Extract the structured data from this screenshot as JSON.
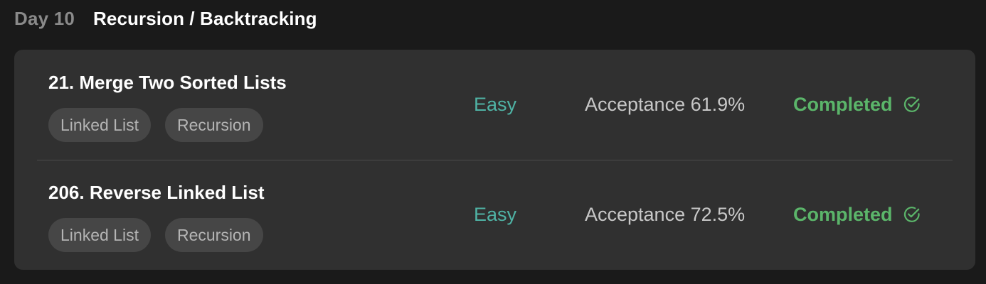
{
  "header": {
    "day": "Day 10",
    "topic": "Recursion / Backtracking"
  },
  "problems": [
    {
      "title": "21. Merge Two Sorted Lists",
      "tags": [
        "Linked List",
        "Recursion"
      ],
      "difficulty": "Easy",
      "acceptance": "Acceptance 61.9%",
      "status": "Completed",
      "status_icon": "check-circle-icon"
    },
    {
      "title": "206. Reverse Linked List",
      "tags": [
        "Linked List",
        "Recursion"
      ],
      "difficulty": "Easy",
      "acceptance": "Acceptance 72.5%",
      "status": "Completed",
      "status_icon": "check-circle-icon"
    }
  ],
  "colors": {
    "background": "#1a1a1a",
    "card": "#303030",
    "tag": "#464646",
    "easy": "#4fb3a5",
    "completed": "#5bb56a"
  }
}
